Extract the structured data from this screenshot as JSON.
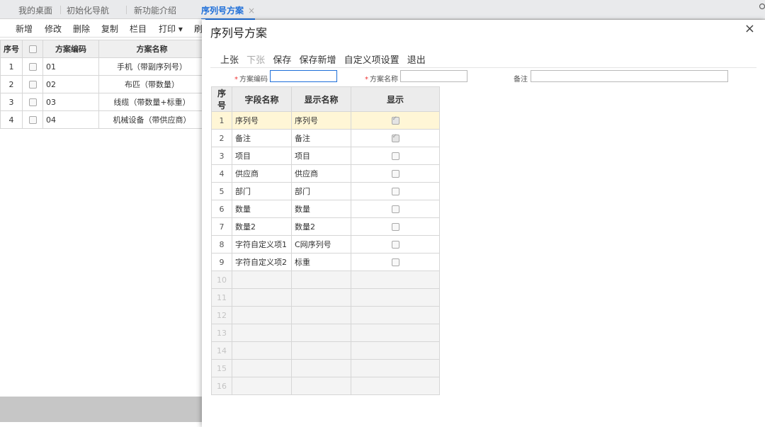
{
  "tabs": [
    {
      "label": "我的桌面"
    },
    {
      "label": "初始化导航"
    },
    {
      "label": "新功能介绍"
    },
    {
      "label": "序列号方案",
      "close": "×"
    }
  ],
  "bg_toolbar": [
    "新增",
    "修改",
    "删除",
    "复制",
    "栏目",
    "打印 ▾",
    "刷"
  ],
  "bg_headers": [
    "序号",
    "",
    "方案编码",
    "方案名称"
  ],
  "bg_rows": [
    {
      "n": "1",
      "code": "01",
      "name": "手机（带副序列号）"
    },
    {
      "n": "2",
      "code": "02",
      "name": "布匹（带数量）"
    },
    {
      "n": "3",
      "code": "03",
      "name": "线缆（带数量+标重）"
    },
    {
      "n": "4",
      "code": "04",
      "name": "机械设备（带供应商）"
    }
  ],
  "dialog": {
    "title": "序列号方案",
    "close": "×",
    "toolbar": [
      "上张",
      "下张",
      "保存",
      "保存新增",
      "自定义项设置",
      "退出"
    ],
    "fields": {
      "code_label": "方案编码",
      "name_label": "方案名称",
      "note_label": "备注",
      "code_value": "",
      "name_value": "",
      "note_value": ""
    },
    "headers": [
      "序号",
      "字段名称",
      "显示名称",
      "显示"
    ],
    "rows": [
      {
        "n": "1",
        "field": "序列号",
        "display": "序列号",
        "show": true
      },
      {
        "n": "2",
        "field": "备注",
        "display": "备注",
        "show": true
      },
      {
        "n": "3",
        "field": "项目",
        "display": "项目",
        "show": false
      },
      {
        "n": "4",
        "field": "供应商",
        "display": "供应商",
        "show": false
      },
      {
        "n": "5",
        "field": "部门",
        "display": "部门",
        "show": false
      },
      {
        "n": "6",
        "field": "数量",
        "display": "数量",
        "show": false
      },
      {
        "n": "7",
        "field": "数量2",
        "display": "数量2",
        "show": false
      },
      {
        "n": "8",
        "field": "字符自定义项1",
        "display": "C网序列号",
        "show": false
      },
      {
        "n": "9",
        "field": "字符自定义项2",
        "display": "标重",
        "show": false
      }
    ],
    "empty_rows": [
      "10",
      "11",
      "12",
      "13",
      "14",
      "15",
      "16"
    ]
  },
  "colors": {
    "accent": "#1e6fd9",
    "highlight_row": "#fff6d6",
    "required": "#e33333"
  }
}
